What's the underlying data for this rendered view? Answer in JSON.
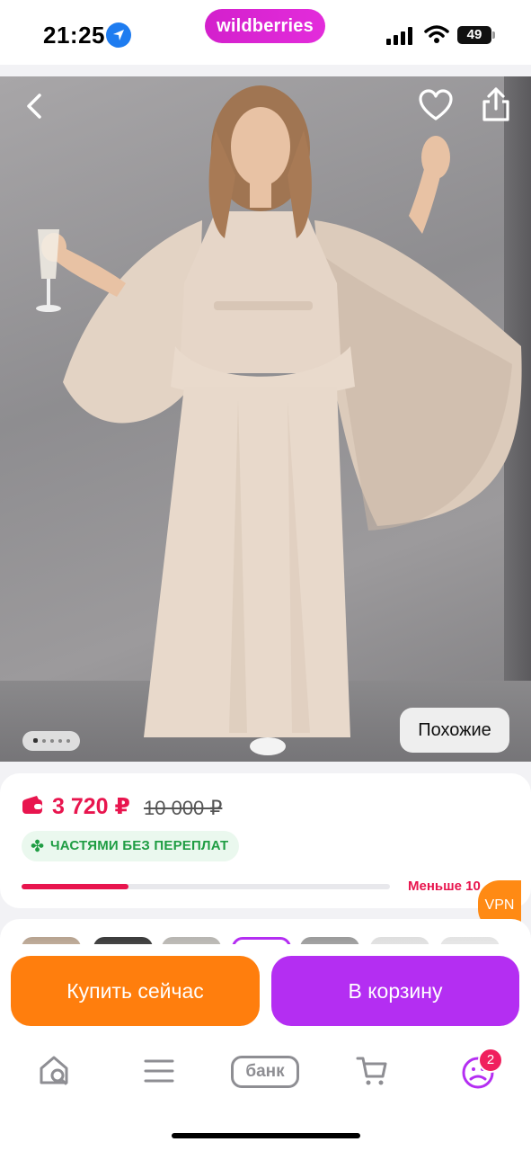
{
  "status_bar": {
    "time": "21:25",
    "app_pill": "wildberries",
    "battery": "49"
  },
  "product": {
    "image_alt": "Beige satin dress with cape",
    "gallery_count": 5,
    "gallery_active": 1,
    "similar_label": "Похожие",
    "price_current": "3 720 ₽",
    "price_old": "10 000 ₽",
    "installment": "ЧАСТЯМИ БЕЗ ПЕРЕПЛАТ",
    "stock_text": "Меньше 10",
    "stock_fraction": 0.29
  },
  "vpn_badge": "VPN",
  "actions": {
    "buy_now": "Купить сейчас",
    "add_to_cart": "В корзину"
  },
  "bottom_nav": {
    "items": [
      {
        "icon": "home-search-icon"
      },
      {
        "icon": "menu-icon"
      },
      {
        "icon": "bank-icon",
        "label": "банк"
      },
      {
        "icon": "cart-icon"
      },
      {
        "icon": "profile-icon",
        "badge": "2"
      }
    ]
  },
  "colors": {
    "brand_pill": "#d320cc",
    "price": "#e8154e",
    "installment_green": "#1f9d43",
    "buy_now": "#ff7e0d",
    "cart": "#b42ef2",
    "badge": "#f0205e"
  }
}
